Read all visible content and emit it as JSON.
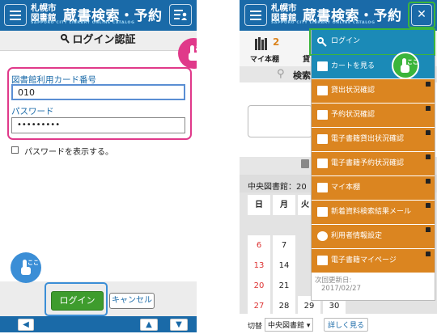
{
  "left": {
    "logo": {
      "city_line1": "札幌市",
      "city_line2": "図書館",
      "title": "蔵書検索・予約",
      "subtitle": "SAPPORO CITY LIBRARY ONLINE CATALOG"
    },
    "page_title": "ログイン認証",
    "card_label": "図書館利用カード番号",
    "card_value": "010",
    "password_label": "パスワード",
    "password_value": "•••••••••",
    "show_password_label": "パスワードを表示する。",
    "login_button": "ログイン",
    "cancel_button": "キャンセル",
    "callout_text": "ここ"
  },
  "right": {
    "logo": {
      "city_line1": "札幌市",
      "city_line2": "図書館",
      "title": "蔵書検索・予約",
      "subtitle": "SAPPORO CITY LIBRARY ONLINE CATALOG"
    },
    "close_glyph": "✕",
    "bookshelf": {
      "count": "2",
      "label": "マイ本棚",
      "next_label": "貸"
    },
    "search_partial": "検索",
    "branch_text": "中央図書館：20",
    "calendar": {
      "headers": [
        "日",
        "月",
        "火"
      ],
      "rows": [
        [
          "6",
          "7"
        ],
        [
          "13",
          "14"
        ],
        [
          "20",
          "21"
        ],
        [
          "27",
          "28",
          "29",
          "30"
        ]
      ]
    },
    "footer_switch_label": "切替",
    "footer_select": "中央図書館",
    "footer_more_button": "詳しく見る",
    "callout_text": "ここ",
    "menu": {
      "items": [
        {
          "label": "ログイン",
          "icon": "key-icon"
        },
        {
          "label": "カートを見る",
          "icon": "cart-icon"
        },
        {
          "label": "貸出状況確認",
          "icon": "house-icon"
        },
        {
          "label": "予約状況確認",
          "icon": "book-edit-icon"
        },
        {
          "label": "電子書籍貸出状況確認",
          "icon": "ebook-house-icon"
        },
        {
          "label": "電子書籍予約状況確認",
          "icon": "ebook-edit-icon"
        },
        {
          "label": "マイ本棚",
          "icon": "bookshelf-icon"
        },
        {
          "label": "新着資料検索結果メール",
          "icon": "new-mail-icon"
        },
        {
          "label": "利用者情報設定",
          "icon": "gear-icon"
        },
        {
          "label": "電子書籍マイページ",
          "icon": "person-icon"
        }
      ],
      "update_label": "次回更新日:",
      "update_date": "2017/02/27"
    }
  },
  "colors": {
    "header_blue": "#1a6aa8",
    "menu_orange": "#db8520",
    "highlight_pink": "#e0398a",
    "highlight_green": "#3bb53b",
    "callout_blue": "#3b8ed6"
  }
}
